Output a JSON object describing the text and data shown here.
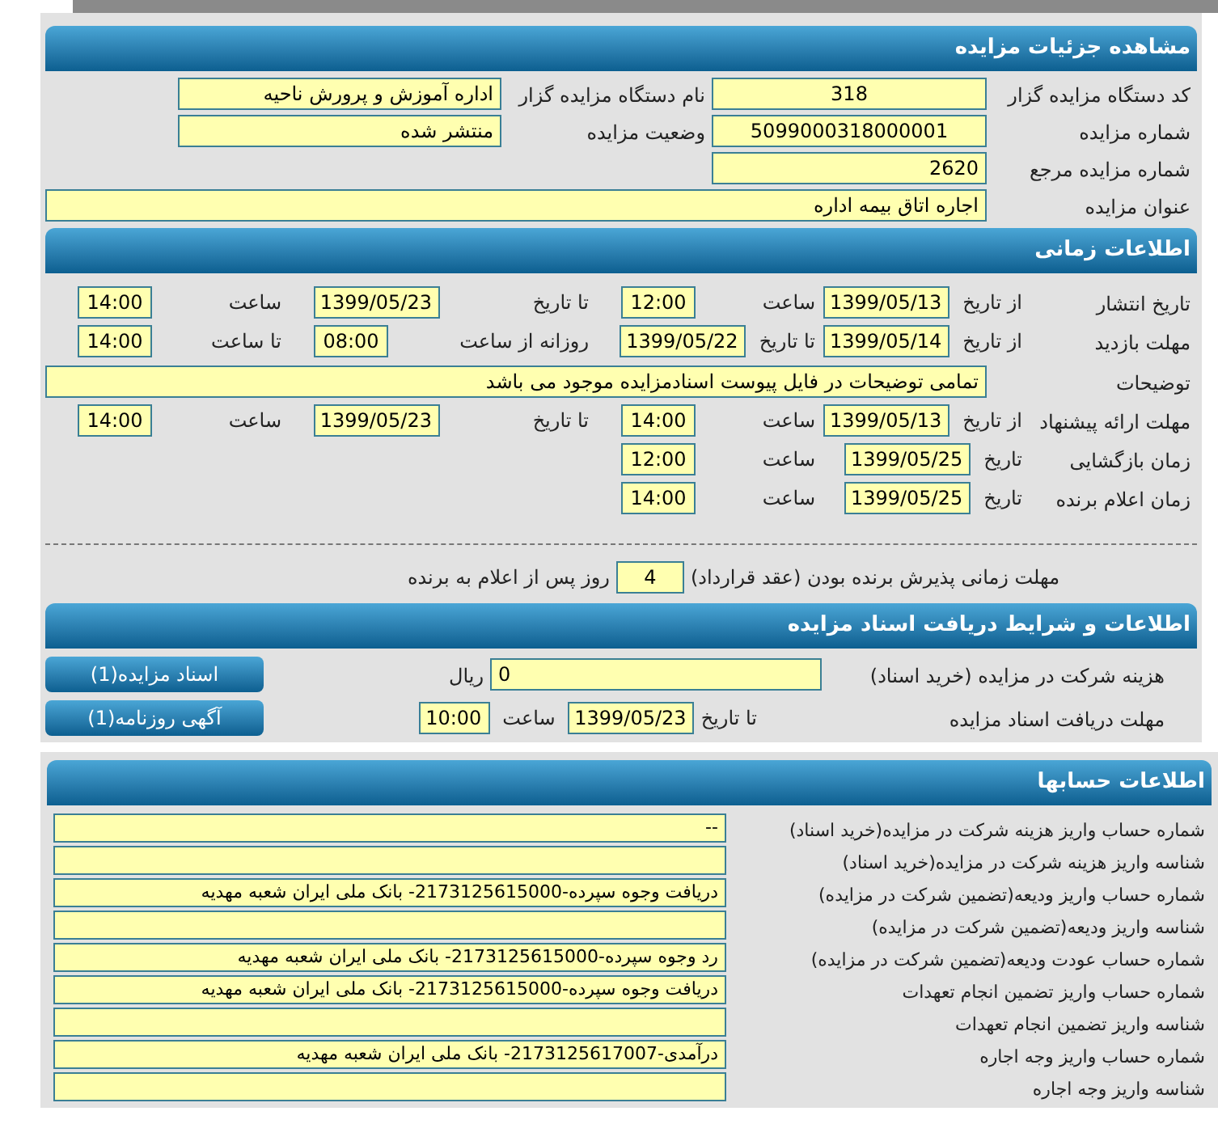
{
  "details": {
    "title": "مشاهده جزئیات مزایده",
    "rows": [
      [
        {
          "label": "کد دستگاه مزایده گزار",
          "value": "318"
        },
        {
          "label": "نام دستگاه مزایده گزار",
          "value": "اداره آموزش و پرورش ناحیه"
        }
      ],
      [
        {
          "label": "شماره مزایده",
          "value": "5099000318000001"
        },
        {
          "label": "وضعیت مزایده",
          "value": "منتشر شده"
        }
      ],
      [
        {
          "label": "شماره مزایده مرجع",
          "value": "2620"
        }
      ]
    ],
    "subject": {
      "label": "عنوان مزایده",
      "value": "اجاره اتاق بیمه اداره"
    }
  },
  "timing": {
    "title": "اطلاعات زمانی",
    "rows": [
      {
        "kind": "pairs",
        "label": "تاریخ انتشار",
        "pairs": [
          {
            "label": "از تاریخ",
            "value": "1399/05/13",
            "kind": "date"
          },
          {
            "label": "ساعت",
            "value": "12:00",
            "kind": "time"
          },
          {
            "label": "تا تاریخ",
            "value": "1399/05/23",
            "kind": "date"
          },
          {
            "label": "ساعت",
            "value": "14:00",
            "kind": "time"
          }
        ]
      },
      {
        "kind": "pairs",
        "label": "مهلت بازدید",
        "pairs": [
          {
            "label": "از تاریخ",
            "value": "1399/05/14",
            "kind": "date"
          },
          {
            "label": "تا تاریخ",
            "value": "1399/05/22",
            "kind": "date"
          },
          {
            "label": "روزانه از ساعت",
            "value": "08:00",
            "kind": "time"
          },
          {
            "label": "تا ساعت",
            "value": "14:00",
            "kind": "time"
          }
        ]
      },
      {
        "kind": "note",
        "label": "توضیحات",
        "value": "تمامی توضیحات در فایل پیوست اسنادمزایده موجود می باشد"
      },
      {
        "kind": "pairs",
        "label": "مهلت ارائه پیشنهاد",
        "pairs": [
          {
            "label": "از تاریخ",
            "value": "1399/05/13",
            "kind": "date"
          },
          {
            "label": "ساعت",
            "value": "14:00",
            "kind": "time"
          },
          {
            "label": "تا تاریخ",
            "value": "1399/05/23",
            "kind": "date"
          },
          {
            "label": "ساعت",
            "value": "14:00",
            "kind": "time"
          }
        ]
      },
      {
        "kind": "pairs",
        "label": "زمان بازگشایی",
        "pairs": [
          {
            "label": "تاریخ",
            "value": "1399/05/25",
            "kind": "date"
          },
          {
            "label": "ساعت",
            "value": "12:00",
            "kind": "time"
          }
        ]
      },
      {
        "kind": "pairs",
        "label": "زمان اعلام برنده",
        "pairs": [
          {
            "label": "تاریخ",
            "value": "1399/05/25",
            "kind": "date"
          },
          {
            "label": "ساعت",
            "value": "14:00",
            "kind": "time"
          }
        ]
      }
    ],
    "acceptance": {
      "label": "مهلت زمانی پذیرش برنده بودن (عقد قرارداد)",
      "value": "4",
      "suffix": "روز پس از اعلام به برنده"
    }
  },
  "documents": {
    "title": "اطلاعات و شرایط دریافت اسناد مزایده",
    "fee": {
      "label": "هزینه شرکت در مزایده (خرید اسناد)",
      "value": "0",
      "unit": "ریال"
    },
    "deadline": {
      "label": "مهلت دریافت اسناد مزایده",
      "date_label": "تا تاریخ",
      "date": "1399/05/23",
      "time_label": "ساعت",
      "time": "10:00"
    },
    "buttons": [
      "اسناد مزایده(1)",
      "آگهی روزنامه(1)"
    ]
  },
  "accounts": {
    "title": "اطلاعات حسابها",
    "rows": [
      {
        "label": "شماره حساب واریز هزینه شرکت در مزایده(خرید اسناد)",
        "value": "--"
      },
      {
        "label": "شناسه واریز هزینه شرکت در مزایده(خرید اسناد)"
      },
      {
        "label": "شماره حساب واریز ودیعه(تضمین شرکت در مزایده)",
        "value": "دریافت وجوه سپرده-2173125615000- بانک ملی ایران شعبه مهدیه"
      },
      {
        "label": "شناسه واریز ودیعه(تضمین شرکت در مزایده)"
      },
      {
        "label": "شماره حساب عودت ودیعه(تضمین شرکت در مزایده)",
        "value": "رد وجوه سپرده-2173125615000- بانک ملی ایران شعبه مهدیه"
      },
      {
        "label": "شماره حساب واریز تضمین انجام تعهدات",
        "value": "دریافت وجوه سپرده-2173125615000- بانک ملی ایران شعبه مهدیه"
      },
      {
        "label": "شناسه واریز تضمین انجام تعهدات"
      },
      {
        "label": "شماره حساب واریز وجه اجاره",
        "value": "درآمدی-2173125617007- بانک ملی ایران شعبه مهدیه"
      },
      {
        "label": "شناسه واریز وجه اجاره"
      }
    ]
  }
}
